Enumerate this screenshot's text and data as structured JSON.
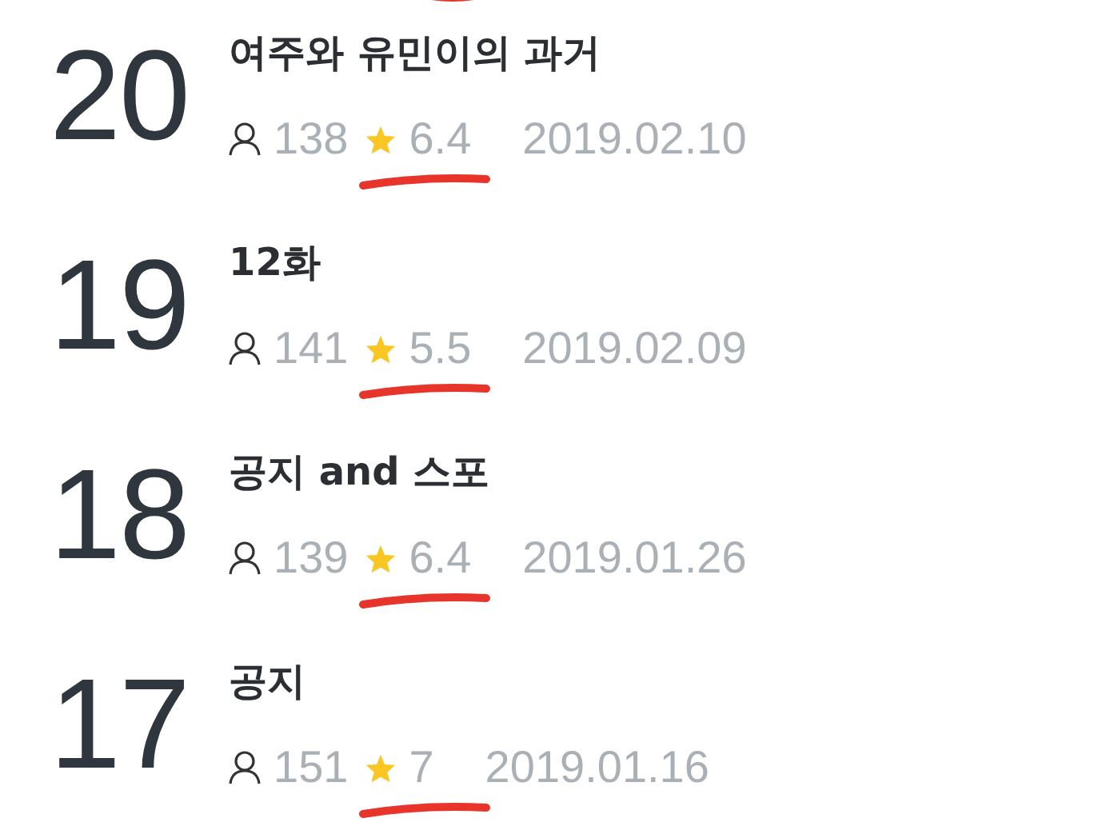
{
  "episodes": [
    {
      "number": "20",
      "title": "여주와 유민이의 과거",
      "views": "138",
      "rating": "6.4",
      "date": "2019.02.10",
      "underlined": true
    },
    {
      "number": "19",
      "title": "12화",
      "views": "141",
      "rating": "5.5",
      "date": "2019.02.09",
      "underlined": true
    },
    {
      "number": "18",
      "title": "공지 and 스포",
      "views": "139",
      "rating": "6.4",
      "date": "2019.01.26",
      "underlined": true
    },
    {
      "number": "17",
      "title": "공지",
      "views": "151",
      "rating": "7",
      "date": "2019.01.16",
      "underlined": true
    }
  ]
}
